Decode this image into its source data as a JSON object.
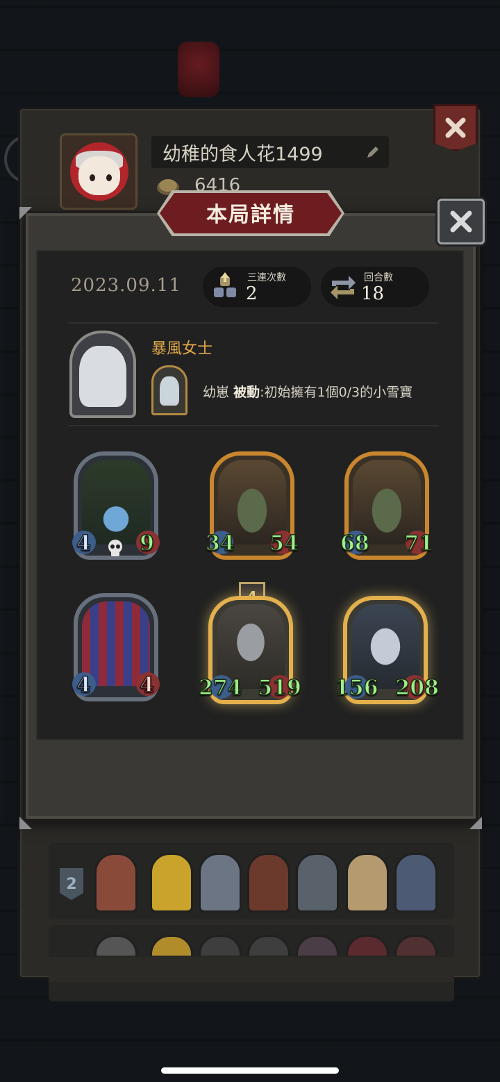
{
  "player": {
    "name": "幼稚的食人花1499",
    "coins": "6416"
  },
  "dialog": {
    "title": "本局詳情",
    "date": "2023.09.11",
    "triple_label": "三連次數",
    "triple_value": "2",
    "rounds_label": "回合數",
    "rounds_value": "18"
  },
  "hero": {
    "name": "暴風女士",
    "skill_name": "幼崽",
    "skill_type": "被動",
    "skill_desc": ":初始擁有1個0/3的小雪寶"
  },
  "cards": [
    {
      "attack": "4",
      "health": "9",
      "style": "silver",
      "art": "vine-crystal"
    },
    {
      "attack": "34",
      "health": "54",
      "style": "gold",
      "art": "goblin"
    },
    {
      "attack": "68",
      "health": "71",
      "style": "gold",
      "art": "goblin"
    },
    {
      "attack": "4",
      "health": "4",
      "style": "silver",
      "art": "jester"
    },
    {
      "attack": "274",
      "health": "519",
      "style": "golden",
      "art": "knight",
      "tier": "4"
    },
    {
      "attack": "156",
      "health": "208",
      "style": "golden",
      "art": "yeti"
    }
  ],
  "history": {
    "rank": "2"
  },
  "colors": {
    "accent_gold": "#e0a64a",
    "stat_green": "#9ff08a",
    "ribbon_red": "#6d1c1f"
  }
}
